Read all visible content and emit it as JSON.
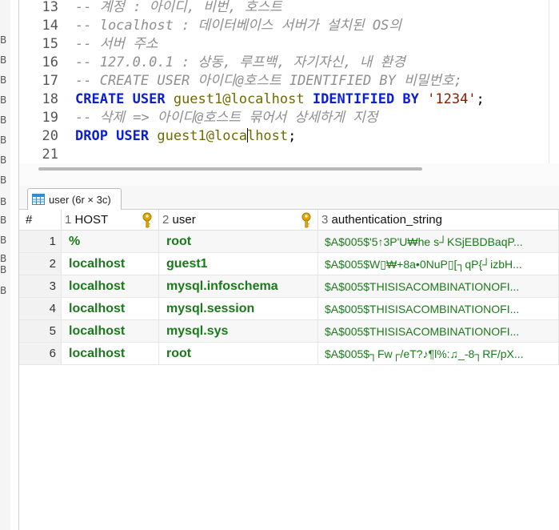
{
  "left_strip": [
    "B",
    "B",
    "B",
    "B",
    "B",
    "B",
    "B",
    "B",
    "B",
    "B",
    "B",
    "B",
    "B",
    "B"
  ],
  "editor": {
    "lines": [
      {
        "n": "13",
        "tokens": [
          {
            "t": "-- 계정 : 아이디, 비번, 호스트",
            "c": "cm"
          }
        ]
      },
      {
        "n": "14",
        "tokens": [
          {
            "t": "-- localhost : 데이터베이스 서버가 설치된 OS의",
            "c": "cm"
          }
        ]
      },
      {
        "n": "15",
        "tokens": [
          {
            "t": "-- 서버 주소",
            "c": "cm"
          }
        ]
      },
      {
        "n": "16",
        "tokens": [
          {
            "t": "-- 127.0.0.1 : 상동, 루프백, 자기자신, 내 환경",
            "c": "cm"
          }
        ]
      },
      {
        "n": "17",
        "tokens": [
          {
            "t": "-- CREATE USER 아이디@호스트 IDENTIFIED BY 비밀번호;",
            "c": "cm"
          }
        ]
      },
      {
        "n": "18",
        "tokens": [
          {
            "t": "CREATE USER ",
            "c": "kw"
          },
          {
            "t": "guest1@localhost ",
            "c": "id"
          },
          {
            "t": "IDENTIFIED BY ",
            "c": "kw"
          },
          {
            "t": "'1234'",
            "c": "str"
          },
          {
            "t": ";",
            "c": "pl"
          }
        ]
      },
      {
        "n": "19",
        "tokens": [
          {
            "t": "-- 삭제 => 아이디@호스트 묶어서 상세하게 지정",
            "c": "cm"
          }
        ]
      },
      {
        "n": "20",
        "tokens": [
          {
            "t": "DROP USER ",
            "c": "kw"
          },
          {
            "t": "guest1@loca",
            "c": "id"
          },
          {
            "t": "|",
            "c": "caret"
          },
          {
            "t": "lhost",
            "c": "id"
          },
          {
            "t": ";",
            "c": "pl"
          }
        ]
      },
      {
        "n": "21",
        "tokens": []
      }
    ]
  },
  "results_tab": {
    "label": "user (6r × 3c)"
  },
  "table": {
    "columns": [
      {
        "num": "#",
        "label": ""
      },
      {
        "num": "1",
        "label": "HOST",
        "key": true
      },
      {
        "num": "2",
        "label": "user",
        "key": true
      },
      {
        "num": "3",
        "label": "authentication_string",
        "key": false
      }
    ],
    "rows": [
      {
        "idx": "1",
        "host": "%",
        "user": "root",
        "auth": "$A$005$'5↑3P'U₩he s┘KSjEBDBaqP..."
      },
      {
        "idx": "2",
        "host": "localhost",
        "user": "guest1",
        "auth": "$A$005$W▯₩+8a•0NuP▯[┐qP{┘izbH..."
      },
      {
        "idx": "3",
        "host": "localhost",
        "user": "mysql.infoschema",
        "auth": "$A$005$THISISACOMBINATIONOFI..."
      },
      {
        "idx": "4",
        "host": "localhost",
        "user": "mysql.session",
        "auth": "$A$005$THISISACOMBINATIONOFI..."
      },
      {
        "idx": "5",
        "host": "localhost",
        "user": "mysql.sys",
        "auth": "$A$005$THISISACOMBINATIONOFI..."
      },
      {
        "idx": "6",
        "host": "localhost",
        "user": "root",
        "auth": "$A$005$┐Fw┌/eT?♪¶l%:♫_-8┐RF/pX..."
      }
    ]
  },
  "colors": {
    "keyword": "#0b1fd1",
    "identifier": "#6f6a00",
    "string": "#8a1a00",
    "comment": "#8f8f8f",
    "cell_text": "#1a7a1a",
    "key_icon": "#e0a800"
  }
}
